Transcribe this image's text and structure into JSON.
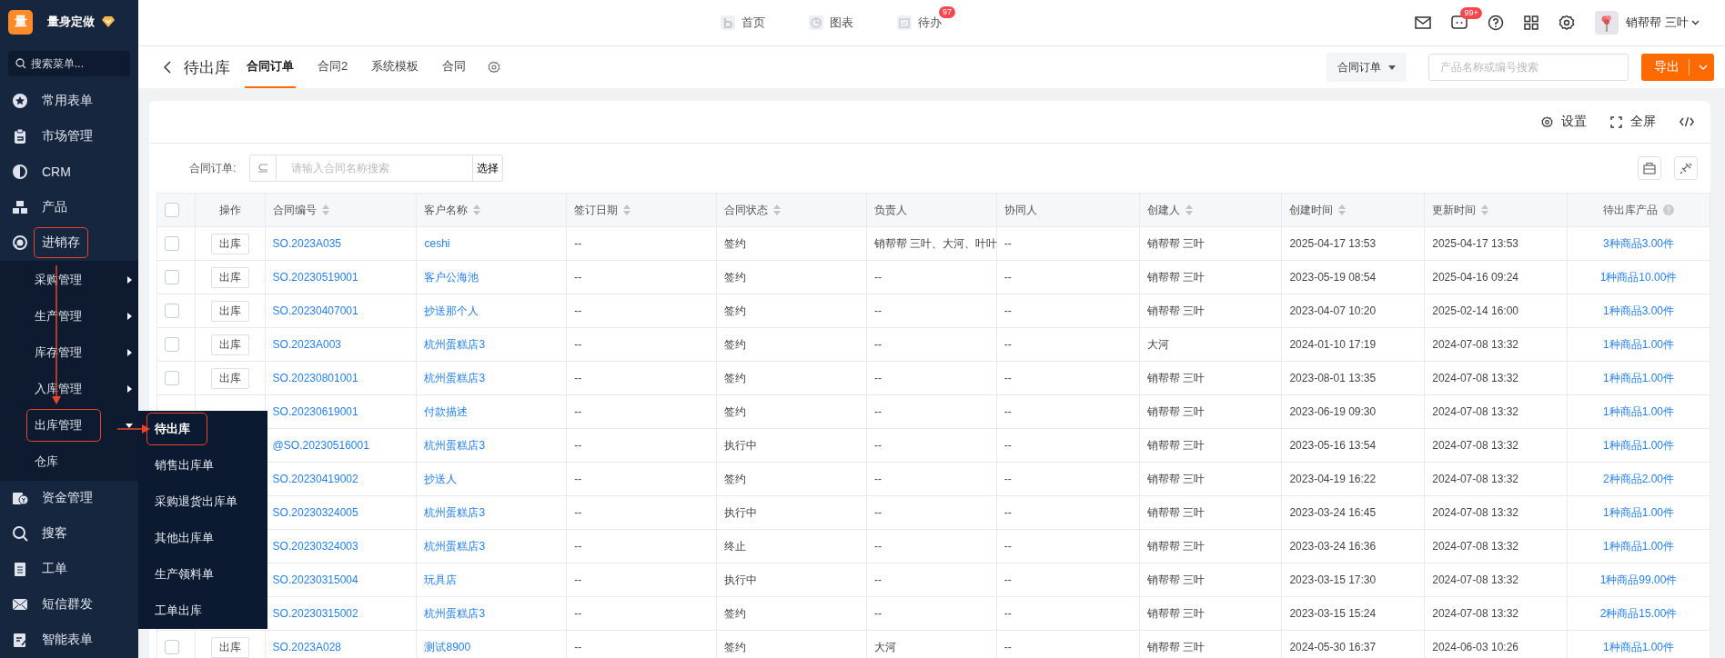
{
  "sidebar": {
    "logo": "量",
    "brand": "量身定做",
    "search_placeholder": "搜索菜单...",
    "items": [
      {
        "label": "常用表单",
        "annotated": false
      },
      {
        "label": "市场管理",
        "annotated": false
      },
      {
        "label": "CRM",
        "annotated": false
      },
      {
        "label": "产品",
        "annotated": false
      },
      {
        "label": "进销存",
        "annotated": true,
        "expanded": true,
        "children": [
          {
            "label": "采购管理",
            "kind": "group",
            "expanded": false,
            "annotated": false
          },
          {
            "label": "生产管理",
            "kind": "group",
            "expanded": false,
            "annotated": false
          },
          {
            "label": "库存管理",
            "kind": "group",
            "expanded": false,
            "annotated": false
          },
          {
            "label": "入库管理",
            "kind": "group",
            "expanded": false,
            "annotated": false
          },
          {
            "label": "出库管理",
            "kind": "group",
            "expanded": true,
            "annotated": true
          },
          {
            "label": "仓库",
            "kind": "link",
            "annotated": false
          }
        ]
      },
      {
        "label": "资金管理",
        "annotated": false
      },
      {
        "label": "搜客",
        "annotated": false
      },
      {
        "label": "工单",
        "annotated": false
      },
      {
        "label": "短信群发",
        "annotated": false
      },
      {
        "label": "智能表单",
        "annotated": false
      }
    ]
  },
  "flyout": {
    "items": [
      {
        "label": "待出库",
        "selected": true,
        "annotated": true
      },
      {
        "label": "销售出库单",
        "selected": false,
        "annotated": false
      },
      {
        "label": "采购退货出库单",
        "selected": false,
        "annotated": false
      },
      {
        "label": "其他出库单",
        "selected": false,
        "annotated": false
      },
      {
        "label": "生产领料单",
        "selected": false,
        "annotated": false
      },
      {
        "label": "工单出库",
        "selected": false,
        "annotated": false
      }
    ]
  },
  "topbar": {
    "nav": [
      {
        "label": "首页"
      },
      {
        "label": "图表"
      },
      {
        "label": "待办",
        "badge": "97"
      }
    ],
    "message_badge": "99+",
    "user": "销帮帮 三叶"
  },
  "header": {
    "title": "待出库",
    "tabs": [
      {
        "label": "合同订单",
        "selected": true
      },
      {
        "label": "合同2",
        "selected": false
      },
      {
        "label": "系统模板",
        "selected": false
      },
      {
        "label": "合同",
        "selected": false
      }
    ],
    "view_select": "合同订单",
    "search_placeholder": "产品名称或编号搜索",
    "export": "导出"
  },
  "toolbar": {
    "settings": "设置",
    "fullscreen": "全屏"
  },
  "filter": {
    "label": "合同订单:",
    "placeholder": "请输入合同名称搜索",
    "button": "选择"
  },
  "table": {
    "columns": [
      {
        "label": "操作",
        "sortable": false,
        "help": false
      },
      {
        "label": "合同编号",
        "sortable": true,
        "help": false
      },
      {
        "label": "客户名称",
        "sortable": true,
        "help": false
      },
      {
        "label": "签订日期",
        "sortable": true,
        "help": false
      },
      {
        "label": "合同状态",
        "sortable": true,
        "help": false
      },
      {
        "label": "负责人",
        "sortable": false,
        "help": false
      },
      {
        "label": "协同人",
        "sortable": false,
        "help": false
      },
      {
        "label": "创建人",
        "sortable": true,
        "help": false
      },
      {
        "label": "创建时间",
        "sortable": true,
        "help": false
      },
      {
        "label": "更新时间",
        "sortable": true,
        "help": false
      },
      {
        "label": "待出库产品",
        "sortable": false,
        "help": true
      }
    ],
    "header_checked": false,
    "rows": [
      {
        "checked": false,
        "cells": [
          "出库",
          "SO.2023A035",
          "ceshi",
          "--",
          "签约",
          "销帮帮 三叶、大河、叶叶",
          "--",
          "销帮帮 三叶",
          "2025-04-17 13:53",
          "2025-04-17 13:53",
          "3种商品3.00件"
        ]
      },
      {
        "checked": false,
        "cells": [
          "出库",
          "SO.20230519001",
          "客户公海池",
          "--",
          "签约",
          "--",
          "--",
          "销帮帮 三叶",
          "2023-05-19 08:54",
          "2025-04-16 09:24",
          "1种商品10.00件"
        ]
      },
      {
        "checked": false,
        "cells": [
          "出库",
          "SO.20230407001",
          "抄送那个人",
          "--",
          "签约",
          "--",
          "--",
          "销帮帮 三叶",
          "2023-04-07 10:20",
          "2025-02-14 16:00",
          "1种商品3.00件"
        ]
      },
      {
        "checked": false,
        "cells": [
          "出库",
          "SO.2023A003",
          "杭州蛋糕店3",
          "--",
          "签约",
          "--",
          "--",
          "大河",
          "2024-01-10 17:19",
          "2024-07-08 13:32",
          "1种商品1.00件"
        ]
      },
      {
        "checked": false,
        "cells": [
          "出库",
          "SO.20230801001",
          "杭州蛋糕店3",
          "--",
          "签约",
          "--",
          "--",
          "销帮帮 三叶",
          "2023-08-01 13:35",
          "2024-07-08 13:32",
          "1种商品1.00件"
        ]
      },
      {
        "cells": [
          "",
          "SO.20230619001",
          "付款描述",
          "--",
          "签约",
          "--",
          "--",
          "销帮帮 三叶",
          "2023-06-19 09:30",
          "2024-07-08 13:32",
          "1种商品1.00件"
        ]
      },
      {
        "cells": [
          "",
          "@SO.20230516001",
          "杭州蛋糕店3",
          "--",
          "执行中",
          "--",
          "--",
          "销帮帮 三叶",
          "2023-05-16 13:54",
          "2024-07-08 13:32",
          "1种商品1.00件"
        ]
      },
      {
        "cells": [
          "",
          "SO.20230419002",
          "抄送人",
          "--",
          "签约",
          "--",
          "--",
          "销帮帮 三叶",
          "2023-04-19 16:22",
          "2024-07-08 13:32",
          "2种商品2.00件"
        ]
      },
      {
        "cells": [
          "",
          "SO.20230324005",
          "杭州蛋糕店3",
          "--",
          "执行中",
          "--",
          "--",
          "销帮帮 三叶",
          "2023-03-24 16:45",
          "2024-07-08 13:32",
          "1种商品1.00件"
        ]
      },
      {
        "cells": [
          "",
          "SO.20230324003",
          "杭州蛋糕店3",
          "--",
          "终止",
          "--",
          "--",
          "销帮帮 三叶",
          "2023-03-24 16:36",
          "2024-07-08 13:32",
          "1种商品1.00件"
        ]
      },
      {
        "cells": [
          "",
          "SO.20230315004",
          "玩具店",
          "--",
          "执行中",
          "--",
          "--",
          "销帮帮 三叶",
          "2023-03-15 17:30",
          "2024-07-08 13:32",
          "1种商品99.00件"
        ]
      },
      {
        "cells": [
          "",
          "SO.20230315002",
          "杭州蛋糕店3",
          "--",
          "签约",
          "--",
          "--",
          "销帮帮 三叶",
          "2023-03-15 15:24",
          "2024-07-08 13:32",
          "2种商品15.00件"
        ]
      },
      {
        "checked": false,
        "cells": [
          "出库",
          "SO.2023A028",
          "测试8900",
          "--",
          "签约",
          "大河",
          "--",
          "销帮帮 三叶",
          "2024-05-30 16:37",
          "2024-06-03 10:26",
          "1种商品1.00件"
        ]
      }
    ]
  }
}
